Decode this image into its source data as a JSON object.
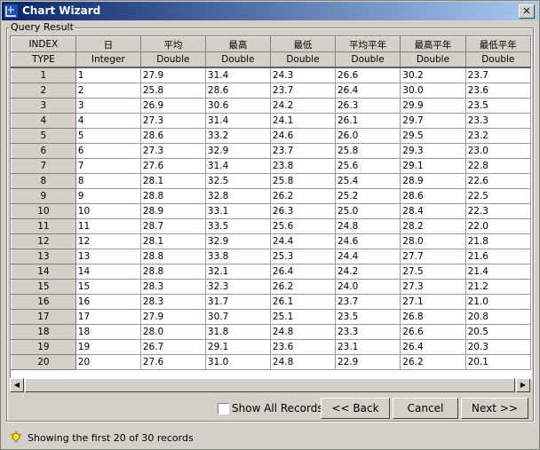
{
  "window": {
    "title": "Chart Wizard",
    "close_glyph": "✕"
  },
  "group": {
    "label": "Query Result"
  },
  "table": {
    "columns": [
      "INDEX",
      "日",
      "平均",
      "最高",
      "最低",
      "平均平年",
      "最高平年",
      "最低平年"
    ],
    "types": [
      "TYPE",
      "Integer",
      "Double",
      "Double",
      "Double",
      "Double",
      "Double",
      "Double"
    ],
    "rows": [
      [
        "1",
        "1",
        "27.9",
        "31.4",
        "24.3",
        "26.6",
        "30.2",
        "23.7"
      ],
      [
        "2",
        "2",
        "25.8",
        "28.6",
        "23.7",
        "26.4",
        "30.0",
        "23.6"
      ],
      [
        "3",
        "3",
        "26.9",
        "30.6",
        "24.2",
        "26.3",
        "29.9",
        "23.5"
      ],
      [
        "4",
        "4",
        "27.3",
        "31.4",
        "24.1",
        "26.1",
        "29.7",
        "23.3"
      ],
      [
        "5",
        "5",
        "28.6",
        "33.2",
        "24.6",
        "26.0",
        "29.5",
        "23.2"
      ],
      [
        "6",
        "6",
        "27.3",
        "32.9",
        "23.7",
        "25.8",
        "29.3",
        "23.0"
      ],
      [
        "7",
        "7",
        "27.6",
        "31.4",
        "23.8",
        "25.6",
        "29.1",
        "22.8"
      ],
      [
        "8",
        "8",
        "28.1",
        "32.5",
        "25.8",
        "25.4",
        "28.9",
        "22.6"
      ],
      [
        "9",
        "9",
        "28.8",
        "32.8",
        "26.2",
        "25.2",
        "28.6",
        "22.5"
      ],
      [
        "10",
        "10",
        "28.9",
        "33.1",
        "26.3",
        "25.0",
        "28.4",
        "22.3"
      ],
      [
        "11",
        "11",
        "28.7",
        "33.5",
        "25.6",
        "24.8",
        "28.2",
        "22.0"
      ],
      [
        "12",
        "12",
        "28.1",
        "32.9",
        "24.4",
        "24.6",
        "28.0",
        "21.8"
      ],
      [
        "13",
        "13",
        "28.8",
        "33.8",
        "25.3",
        "24.4",
        "27.7",
        "21.6"
      ],
      [
        "14",
        "14",
        "28.8",
        "32.1",
        "26.4",
        "24.2",
        "27.5",
        "21.4"
      ],
      [
        "15",
        "15",
        "28.3",
        "32.3",
        "26.2",
        "24.0",
        "27.3",
        "21.2"
      ],
      [
        "16",
        "16",
        "28.3",
        "31.7",
        "26.1",
        "23.7",
        "27.1",
        "21.0"
      ],
      [
        "17",
        "17",
        "27.9",
        "30.7",
        "25.1",
        "23.5",
        "26.8",
        "20.8"
      ],
      [
        "18",
        "18",
        "28.0",
        "31.8",
        "24.8",
        "23.3",
        "26.6",
        "20.5"
      ],
      [
        "19",
        "19",
        "26.7",
        "29.1",
        "23.6",
        "23.1",
        "26.4",
        "20.3"
      ],
      [
        "20",
        "20",
        "27.6",
        "31.0",
        "24.8",
        "22.9",
        "26.2",
        "20.1"
      ]
    ]
  },
  "scrollbar": {
    "left_arrow": "◀",
    "right_arrow": "▶"
  },
  "controls": {
    "show_all_label": "Show All Records",
    "back_label": "<< Back",
    "cancel_label": "Cancel",
    "next_label": "Next >>"
  },
  "status": {
    "text": "Showing the first 20 of 30 records",
    "icon": "lightbulb-icon"
  },
  "colors": {
    "title_start": "#0a246a",
    "title_end": "#a6caf0",
    "face": "#d4d0c8"
  }
}
